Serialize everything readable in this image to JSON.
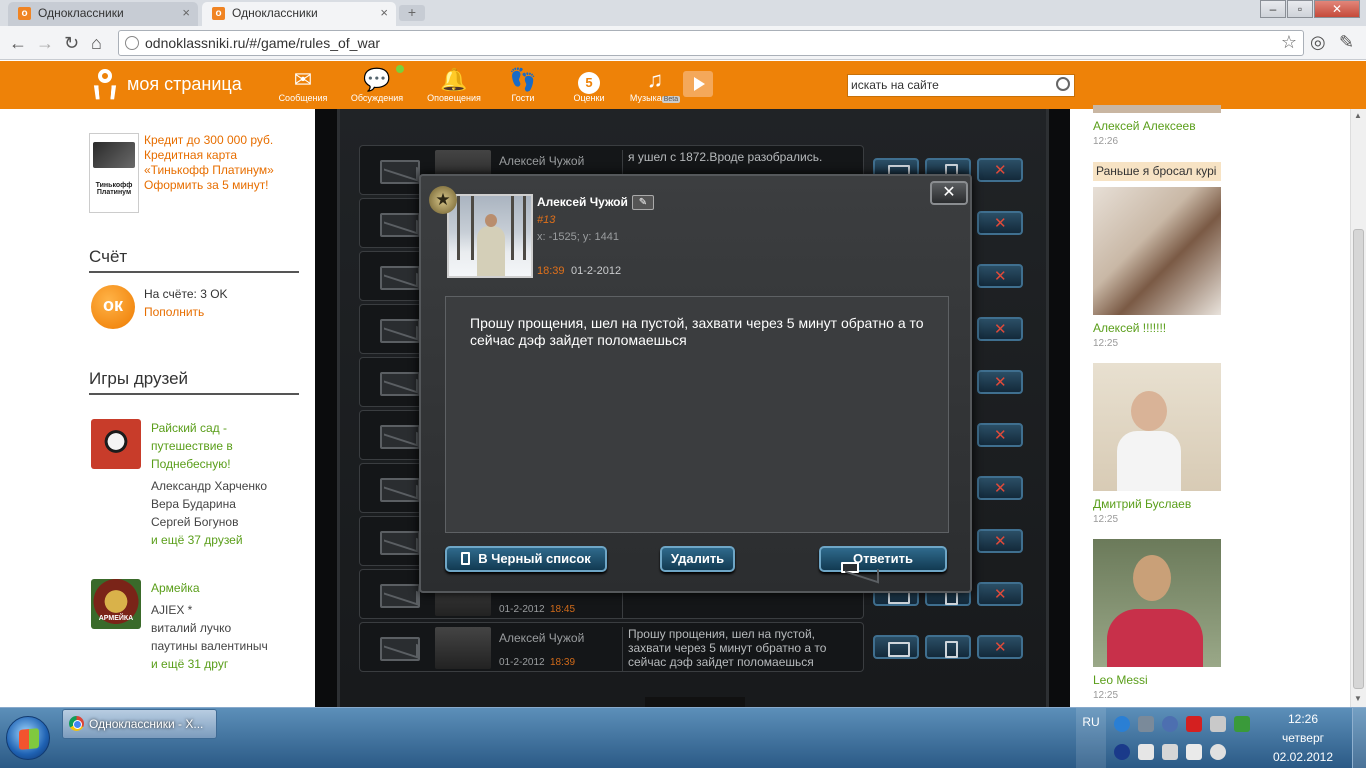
{
  "browser": {
    "tabs": [
      {
        "label": "Одноклассники",
        "active": false
      },
      {
        "label": "Одноклассники",
        "active": true
      }
    ],
    "url": "odnoklassniki.ru/#/game/rules_of_war"
  },
  "header": {
    "brand": "моя страница",
    "nav": [
      {
        "label": "Сообщения",
        "icon": "envelope-icon"
      },
      {
        "label": "Обсуждения",
        "icon": "chat-bubbles-icon"
      },
      {
        "label": "Оповещения",
        "icon": "bell-icon"
      },
      {
        "label": "Гости",
        "icon": "footprints-icon"
      },
      {
        "label": "Оценки",
        "icon": "rating-circle-icon",
        "value": "5"
      },
      {
        "label": "Музыка",
        "icon": "music-note-icon",
        "badge": "Beta"
      }
    ],
    "search_value": "искать на сайте"
  },
  "left": {
    "ad": {
      "card_text": "Тинькофф Платинум",
      "lines": [
        "Кредит до 300 000 руб.",
        "Кредитная карта «Тинькофф Платинум»",
        "Оформить за 5 минут!"
      ]
    },
    "account": {
      "title": "Счёт",
      "balance_label": "На счёте:",
      "balance_value": "3 OK",
      "topup": "Пополнить"
    },
    "friends_games": {
      "title": "Игры друзей",
      "games": [
        {
          "name_line1": "Райский сад -",
          "name_line2": "путешествие в",
          "name_line3": "Поднебесную!",
          "players": [
            "Александр Харченко",
            "Вера Бударина",
            "Сергей Богунов"
          ],
          "more": "и ещё 37 друзей"
        },
        {
          "name_line1": "Армейка",
          "players": [
            "AJIEX *",
            "виталий лучко",
            "паутины валентиныч"
          ],
          "more": "и ещё 31 друг",
          "logo_text": "АРМЕЙКА"
        }
      ]
    }
  },
  "game": {
    "rows": [
      {
        "sender": "Алексей Чужой",
        "snippet": "я ушел с 1872.Вроде разобрались.",
        "date": "",
        "time": ""
      },
      {
        "sender": "",
        "snippet": "",
        "date": "",
        "time": ""
      },
      {
        "sender": "",
        "snippet": "",
        "date": "",
        "time": ""
      },
      {
        "sender": "",
        "snippet": "",
        "date": "",
        "time": ""
      },
      {
        "sender": "",
        "snippet": "",
        "date": "",
        "time": ""
      },
      {
        "sender": "",
        "snippet": "",
        "date": "",
        "time": ""
      },
      {
        "sender": "",
        "snippet": "",
        "date": "",
        "time": ""
      },
      {
        "sender": "",
        "snippet": "",
        "date": "",
        "time": ""
      },
      {
        "sender": "",
        "snippet": "",
        "date": "01-2-2012",
        "time": "18:45"
      },
      {
        "sender": "Алексей Чужой",
        "snippet": "Прошу прощения, шел на пустой, захвати через 5 минут обратно а то сейчас дэф зайдет поломаешься",
        "date": "01-2-2012",
        "time": "18:39"
      }
    ]
  },
  "modal": {
    "name": "Алексей Чужой",
    "id": "#13",
    "coords": "x: -1525; y: 1441",
    "time": "18:39",
    "date": "01-2-2012",
    "text": "Прошу прощения, шел на пустой, захвати через 5 минут обратно а то сейчас дэф зайдет поломаешься",
    "buttons": {
      "blacklist": "В Черный список",
      "delete": "Удалить",
      "reply": "Ответить"
    }
  },
  "right": {
    "users": [
      {
        "name": "Алексей Алексеев",
        "time": "12:26"
      },
      {
        "status": "Раньше я бросал курі",
        "name": "Алексей !!!!!!!",
        "time": "12:25"
      },
      {
        "name": "Дмитрий Буслаев",
        "time": "12:25"
      },
      {
        "name": "Leo Messi",
        "time": "12:25"
      }
    ]
  },
  "taskbar": {
    "task": "Одноклассники - Х...",
    "lang": "RU",
    "time": "12:26",
    "day": "четверг",
    "date": "02.02.2012"
  },
  "colors": {
    "ok_orange": "#ee8208",
    "link_green": "#5a9e1a",
    "accent_orange": "#e0701a"
  }
}
